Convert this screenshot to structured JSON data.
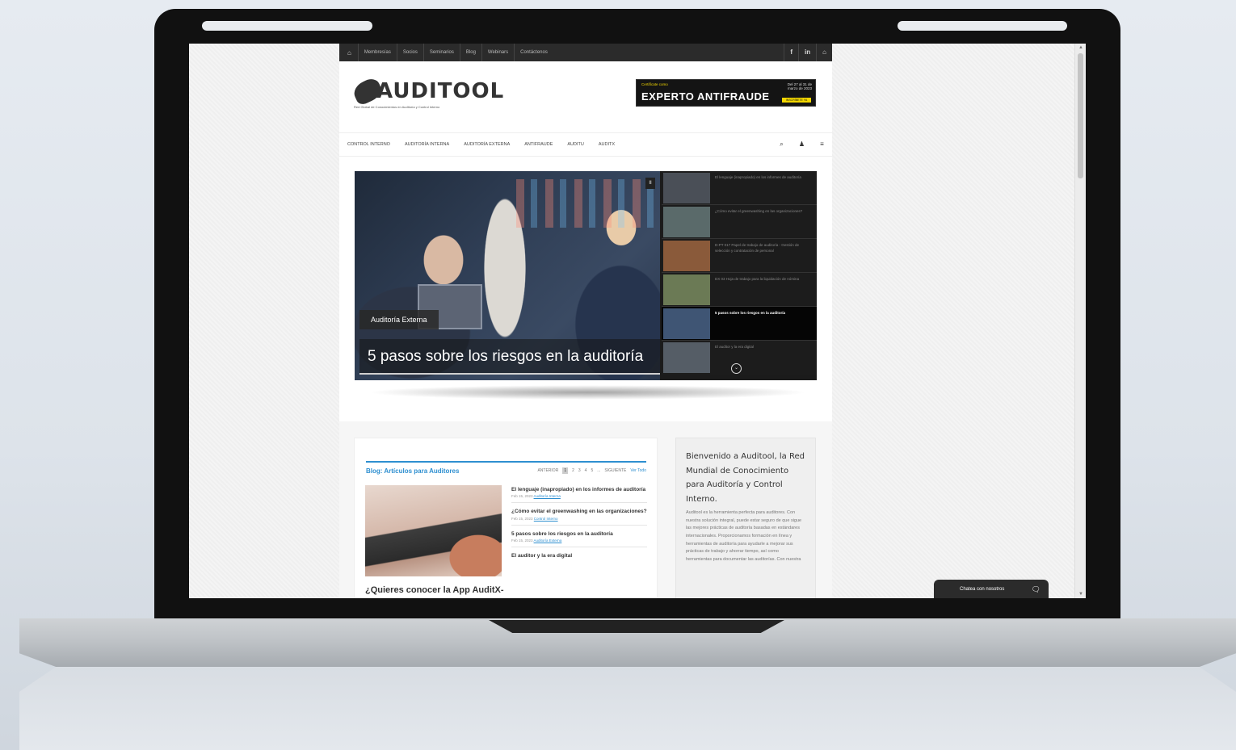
{
  "topbar": {
    "home_icon": "⌂",
    "items": [
      "Membresías",
      "Socios",
      "Seminarios",
      "Blog",
      "Webinars",
      "Contáctenos"
    ],
    "social": [
      "f",
      "in",
      "⌂"
    ]
  },
  "header": {
    "logo_text": "AUDITOOL",
    "logo_sub": "Red Global de Conocimientos en Auditoría y Control Interno",
    "banner": {
      "small": "Certifícate como",
      "big": "EXPERTO ANTIFRAUDE",
      "date": "Del 27 al 31 de marzo de 2023",
      "button": "INSCRÍBETE YA"
    }
  },
  "nav": {
    "items": [
      "CONTROL INTERNO",
      "AUDITORÍA INTERNA",
      "AUDITORÍA EXTERNA",
      "ANTIFRAUDE",
      "AUDITU",
      "AUDITX"
    ],
    "icons": [
      "search-icon",
      "user-icon",
      "menu-icon"
    ],
    "icon_glyphs": [
      "⌕",
      "♟",
      "≡"
    ]
  },
  "slider": {
    "category": "Auditoría Externa",
    "title": "5 pasos sobre los riesgos en la auditoría",
    "pause_glyph": "II",
    "down_glyph": "⌄",
    "thumbs": [
      "El lenguaje (inapropiado) en los informes de auditoría",
      "¿Cómo evitar el greenwashing en las organizaciones?",
      "D-PT 017 Papel de trabajo de auditoría - Gestión de selección y contratación de personal",
      "DX 03 Hoja de trabajo para la liquidación de nómina",
      "5 pasos sobre los riesgos en la auditoría",
      "El auditor y la era digital"
    ],
    "active_index": 4
  },
  "blog": {
    "title": "Blog: Artículos para Auditores",
    "pager": {
      "prev": "ANTERIOR",
      "pages": [
        "1",
        "2",
        "3",
        "4",
        "5",
        "..."
      ],
      "next": "SIGUIENTE",
      "all": "Ver Todo"
    },
    "items": [
      {
        "title": "El lenguaje (inapropiado) en los informes de auditoría",
        "date": "Feb 15, 2023",
        "category": "Auditoría Interna"
      },
      {
        "title": "¿Cómo evitar el greenwashing en las organizaciones?",
        "date": "Feb 15, 2023",
        "category": "Control Interno"
      },
      {
        "title": "5 pasos sobre los riesgos en la auditoría",
        "date": "Feb 15, 2023",
        "category": "Auditoría Externa"
      },
      {
        "title": "El auditor y la era digital",
        "date": "",
        "category": ""
      }
    ],
    "promo": "¿Quieres conocer la App AuditX-"
  },
  "welcome": {
    "title": "Bienvenido a Auditool, la Red Mundial de Conocimiento para Auditoría y Control Interno.",
    "text": "Auditool es la herramienta perfecta para auditores. Con nuestra solución integral, puede estar seguro de que sigue las mejores prácticas de auditoría basadas en estándares internacionales. Proporcionamos formación en línea y herramientas de auditoría para ayudarle a mejorar sus prácticas de trabajo y ahorrar tiempo, así como herramientas para documentar las auditorías. Con nuestra"
  },
  "chat": {
    "label": "Chatea con nosotros",
    "icon": "chat-bubble-icon",
    "glyph": "🗨"
  }
}
